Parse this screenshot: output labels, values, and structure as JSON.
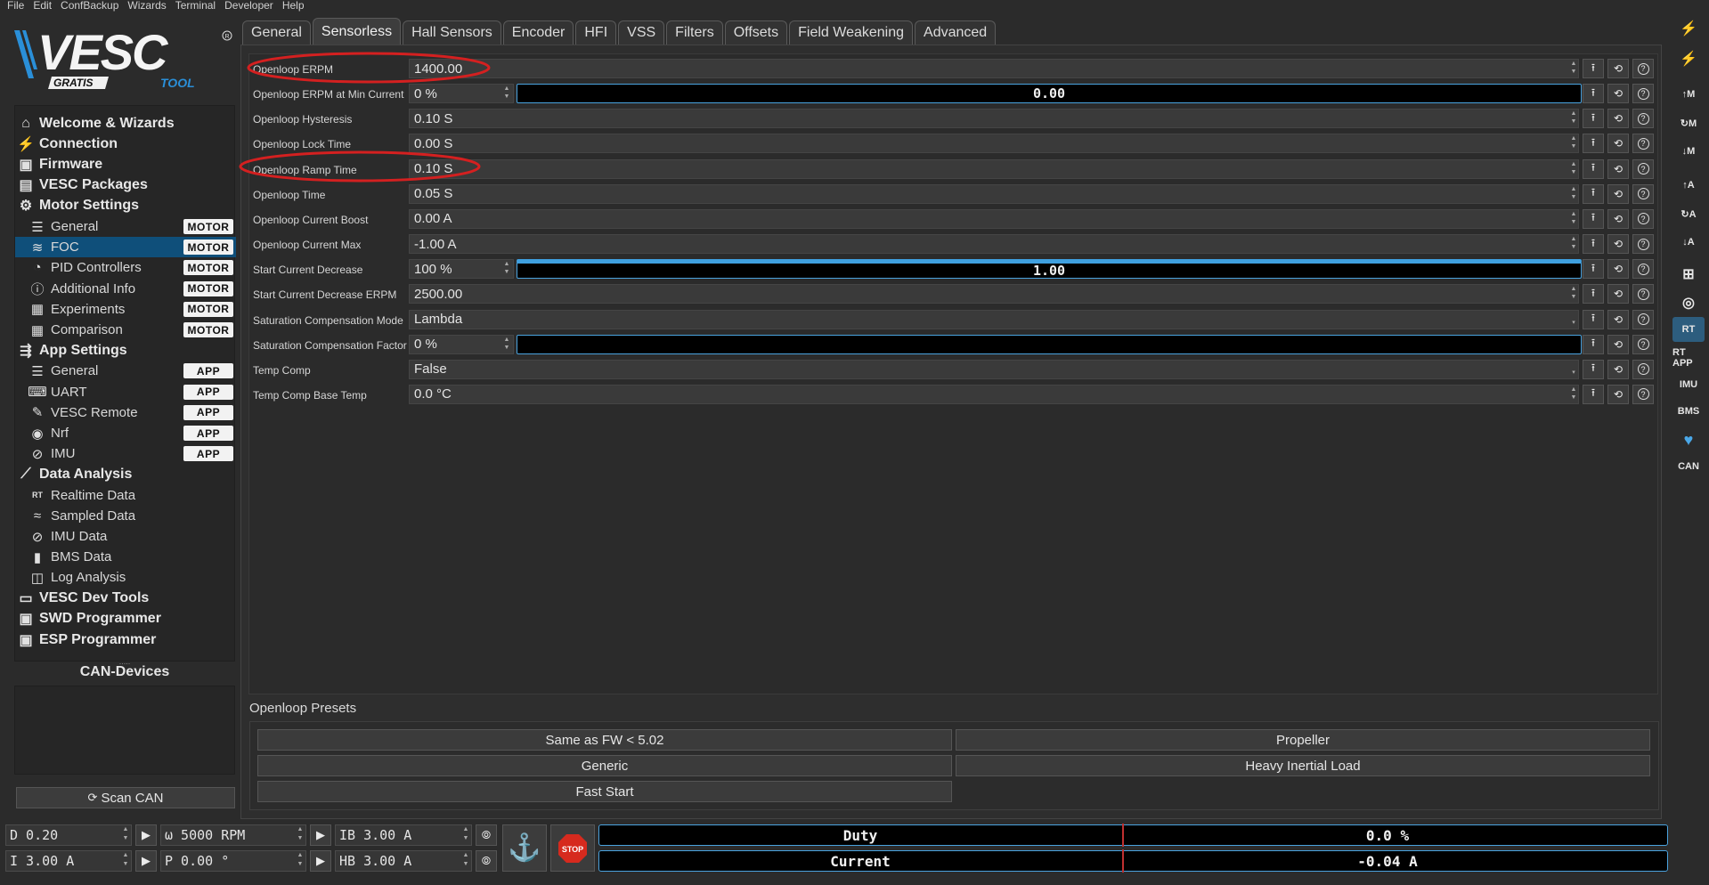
{
  "menu": [
    "File",
    "Edit",
    "ConfBackup",
    "Wizards",
    "Terminal",
    "Developer",
    "Help"
  ],
  "logo": {
    "brand": "VESC",
    "sub1": "GRATIS",
    "sub2": "TOOL"
  },
  "sidebar": {
    "items": [
      {
        "label": "Welcome & Wizards",
        "icon": "home-icon",
        "level": 0
      },
      {
        "label": "Connection",
        "icon": "plug-icon",
        "level": 0
      },
      {
        "label": "Firmware",
        "icon": "chip-icon",
        "level": 0
      },
      {
        "label": "VESC Packages",
        "icon": "package-icon",
        "level": 0
      },
      {
        "label": "Motor Settings",
        "icon": "motor-icon",
        "level": 0
      },
      {
        "label": "General",
        "icon": "sliders-icon",
        "level": 1,
        "badge": "MOTOR"
      },
      {
        "label": "FOC",
        "icon": "coil-icon",
        "level": 1,
        "badge": "MOTOR",
        "selected": true
      },
      {
        "label": "PID Controllers",
        "icon": "gauge-icon",
        "level": 1,
        "badge": "MOTOR"
      },
      {
        "label": "Additional Info",
        "icon": "info-icon",
        "level": 1,
        "badge": "MOTOR"
      },
      {
        "label": "Experiments",
        "icon": "calculator-icon",
        "level": 1,
        "badge": "MOTOR"
      },
      {
        "label": "Comparison",
        "icon": "calculator-icon",
        "level": 1,
        "badge": "MOTOR"
      },
      {
        "label": "App Settings",
        "icon": "app-settings-icon",
        "level": 0
      },
      {
        "label": "General",
        "icon": "sliders-icon",
        "level": 1,
        "badge": "APP"
      },
      {
        "label": "UART",
        "icon": "keyboard-icon",
        "level": 1,
        "badge": "APP"
      },
      {
        "label": "VESC Remote",
        "icon": "remote-icon",
        "level": 1,
        "badge": "APP"
      },
      {
        "label": "Nrf",
        "icon": "radio-icon",
        "level": 1,
        "badge": "APP"
      },
      {
        "label": "IMU",
        "icon": "imu-icon",
        "level": 1,
        "badge": "APP"
      },
      {
        "label": "Data Analysis",
        "icon": "chart-icon",
        "level": 0
      },
      {
        "label": "Realtime Data",
        "icon": "rt-icon",
        "level": 1
      },
      {
        "label": "Sampled Data",
        "icon": "wave-icon",
        "level": 1
      },
      {
        "label": "IMU Data",
        "icon": "imu-icon",
        "level": 1
      },
      {
        "label": "BMS Data",
        "icon": "battery-icon",
        "level": 1
      },
      {
        "label": "Log Analysis",
        "icon": "log-icon",
        "level": 1
      },
      {
        "label": "VESC Dev Tools",
        "icon": "terminal-icon",
        "level": 0
      },
      {
        "label": "SWD Programmer",
        "icon": "chip-icon",
        "level": 0
      },
      {
        "label": "ESP Programmer",
        "icon": "chip-icon",
        "level": 0
      }
    ]
  },
  "can": {
    "title": "CAN-Devices",
    "scan_label": "Scan CAN"
  },
  "tabs": [
    "General",
    "Sensorless",
    "Hall Sensors",
    "Encoder",
    "HFI",
    "VSS",
    "Filters",
    "Offsets",
    "Field Weakening",
    "Advanced"
  ],
  "active_tab": "Sensorless",
  "params": [
    {
      "label": "Openloop ERPM",
      "value": "1400.00",
      "kind": "num",
      "highlight": true
    },
    {
      "label": "Openloop ERPM at Min Current",
      "value": "0 %",
      "kind": "pct",
      "bar_text": "0.00",
      "bar_fraction": 0
    },
    {
      "label": "Openloop Hysteresis",
      "value": "0.10 S",
      "kind": "num"
    },
    {
      "label": "Openloop Lock Time",
      "value": "0.00 S",
      "kind": "num"
    },
    {
      "label": "Openloop Ramp Time",
      "value": "0.10 S",
      "kind": "num",
      "highlight": true
    },
    {
      "label": "Openloop Time",
      "value": "0.05 S",
      "kind": "num"
    },
    {
      "label": "Openloop Current Boost",
      "value": "0.00 A",
      "kind": "num"
    },
    {
      "label": "Openloop Current Max",
      "value": "-1.00 A",
      "kind": "num"
    },
    {
      "label": "Start Current Decrease",
      "value": "100 %",
      "kind": "pct",
      "bar_text": "1.00",
      "bar_fraction": 1
    },
    {
      "label": "Start Current Decrease ERPM",
      "value": "2500.00",
      "kind": "num"
    },
    {
      "label": "Saturation Compensation Mode",
      "value": "Lambda",
      "kind": "enum"
    },
    {
      "label": "Saturation Compensation Factor",
      "value": "0 %",
      "kind": "pct",
      "bar_text": "",
      "bar_fraction": 0
    },
    {
      "label": "Temp Comp",
      "value": "False",
      "kind": "enum"
    },
    {
      "label": "Temp Comp Base Temp",
      "value": "0.0 °C",
      "kind": "num"
    }
  ],
  "presets": {
    "title": "Openloop Presets",
    "buttons": [
      "Same as FW < 5.02",
      "Propeller",
      "Generic",
      "Heavy Inertial Load",
      "Fast Start"
    ]
  },
  "right_toolbar": [
    "plug-icon",
    "plug-icon",
    "fwd-m-label",
    "omega-m-label",
    "rev-m-label",
    "fwd-a-label",
    "omega-a-label",
    "rev-a-label",
    "network-icon",
    "gamepad-icon",
    "rt-icon",
    "rt-app-label",
    "imu-label",
    "bms-label",
    "heart-icon",
    "can-label"
  ],
  "right_labels": {
    "fwd-m-label": "↑M",
    "omega-m-label": "↻M",
    "rev-m-label": "↓M",
    "fwd-a-label": "↑A",
    "omega-a-label": "↻A",
    "rev-a-label": "↓A",
    "rt-app-label": "RT APP",
    "imu-label": "IMU",
    "bms-label": "BMS",
    "can-label": "CAN"
  },
  "bottom": {
    "duty": "D 0.20",
    "speed": "ω 5000 RPM",
    "ib": "IB 3.00 A",
    "current": "I 3.00 A",
    "pos": "P 0.00 °",
    "hb": "HB 3.00 A",
    "stop": "STOP",
    "meters": [
      {
        "label": "Duty",
        "value": "0.0 %"
      },
      {
        "label": "Current",
        "value": "-0.04 A"
      }
    ]
  }
}
